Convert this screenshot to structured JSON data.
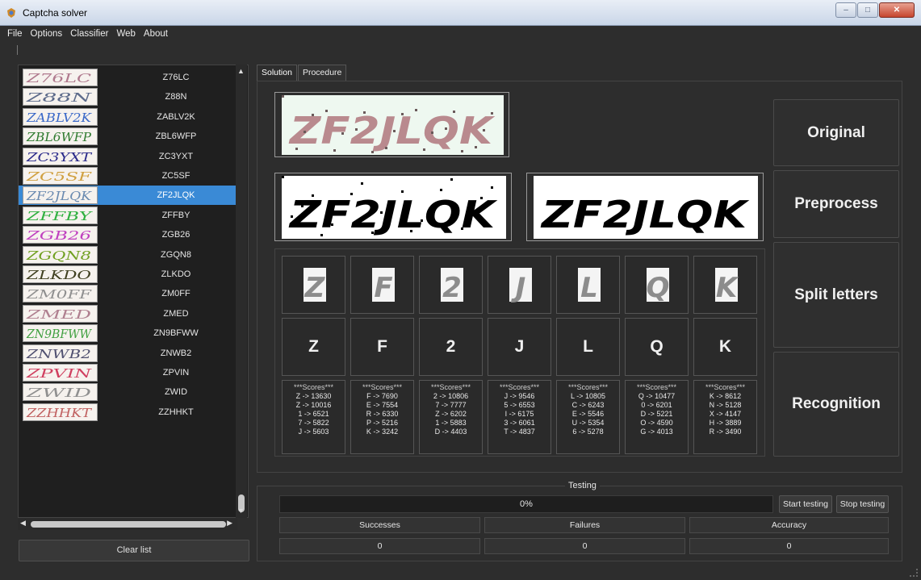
{
  "window": {
    "title": "Captcha solver"
  },
  "menu": [
    "File",
    "Options",
    "Classifier",
    "Web",
    "About"
  ],
  "captcha_list": [
    {
      "label": "Z76LC",
      "thumb_text": "Z76LC",
      "thumb_color": "#b07a8e",
      "selected": false
    },
    {
      "label": "Z88N",
      "thumb_text": "Z88N",
      "thumb_color": "#5c6a8a",
      "selected": false
    },
    {
      "label": "ZABLV2K",
      "thumb_text": "ZABLV2K",
      "thumb_color": "#3a68c8",
      "selected": false
    },
    {
      "label": "ZBL6WFP",
      "thumb_text": "ZBL6WFP",
      "thumb_color": "#2f7a2f",
      "selected": false
    },
    {
      "label": "ZC3YXT",
      "thumb_text": "ZC3YXT",
      "thumb_color": "#2a2a8a",
      "selected": false
    },
    {
      "label": "ZC5SF",
      "thumb_text": "ZC5SF",
      "thumb_color": "#d0a040",
      "selected": false
    },
    {
      "label": "ZF2JLQK",
      "thumb_text": "ZF2JLQK",
      "thumb_color": "#6a8ab0",
      "selected": true
    },
    {
      "label": "ZFFBY",
      "thumb_text": "ZFFBY",
      "thumb_color": "#30b040",
      "selected": false
    },
    {
      "label": "ZGB26",
      "thumb_text": "ZGB26",
      "thumb_color": "#c040c0",
      "selected": false
    },
    {
      "label": "ZGQN8",
      "thumb_text": "ZGQN8",
      "thumb_color": "#70a020",
      "selected": false
    },
    {
      "label": "ZLKDO",
      "thumb_text": "ZLKDO",
      "thumb_color": "#404020",
      "selected": false
    },
    {
      "label": "ZM0FF",
      "thumb_text": "ZM0FF",
      "thumb_color": "#909090",
      "selected": false
    },
    {
      "label": "ZMED",
      "thumb_text": "ZMED",
      "thumb_color": "#b08090",
      "selected": false
    },
    {
      "label": "ZN9BFWW",
      "thumb_text": "ZN9BFWW",
      "thumb_color": "#40a040",
      "selected": false
    },
    {
      "label": "ZNWB2",
      "thumb_text": "ZNWB2",
      "thumb_color": "#505070",
      "selected": false
    },
    {
      "label": "ZPVIN",
      "thumb_text": "ZPVIN",
      "thumb_color": "#d04060",
      "selected": false
    },
    {
      "label": "ZWID",
      "thumb_text": "ZWID",
      "thumb_color": "#909090",
      "selected": false
    },
    {
      "label": "ZZHHKT",
      "thumb_text": "ZZHHKT",
      "thumb_color": "#c06060",
      "selected": false
    }
  ],
  "clear_button": "Clear list",
  "tabs": [
    "Solution",
    "Procedure"
  ],
  "captcha": {
    "text": "ZF2JLQK",
    "original_color": "#b98a8e",
    "original_bg": "#eef8f0"
  },
  "side_buttons": [
    "Original",
    "Preprocess",
    "Split letters",
    "Recognition"
  ],
  "letters": [
    {
      "char": "Z",
      "scores_title": "***Scores***",
      "scores": [
        "Z -> 13630",
        "Z -> 10016",
        "1 -> 6521",
        "7 -> 5822",
        "J -> 5603"
      ]
    },
    {
      "char": "F",
      "scores_title": "***Scores***",
      "scores": [
        "F -> 7690",
        "E -> 7554",
        "R -> 6330",
        "P -> 5216",
        "K -> 3242"
      ]
    },
    {
      "char": "2",
      "scores_title": "***Scores***",
      "scores": [
        "2 -> 10806",
        "7 -> 7777",
        "Z -> 6202",
        "1 -> 5883",
        "D -> 4403"
      ]
    },
    {
      "char": "J",
      "scores_title": "***Scores***",
      "scores": [
        "J -> 9546",
        "5 -> 6553",
        "I -> 6175",
        "3 -> 6061",
        "T -> 4837"
      ]
    },
    {
      "char": "L",
      "scores_title": "***Scores***",
      "scores": [
        "L -> 10805",
        "C -> 6243",
        "E -> 5546",
        "U -> 5354",
        "6 -> 5278"
      ]
    },
    {
      "char": "Q",
      "scores_title": "***Scores***",
      "scores": [
        "Q -> 10477",
        "0 -> 6201",
        "D -> 5221",
        "O -> 4590",
        "G -> 4013"
      ]
    },
    {
      "char": "K",
      "scores_title": "***Scores***",
      "scores": [
        "K -> 8612",
        "N -> 5128",
        "X -> 4147",
        "H -> 3889",
        "R -> 3490"
      ]
    }
  ],
  "testing": {
    "label": "Testing",
    "progress_text": "0%",
    "progress": 0,
    "start_button": "Start testing",
    "stop_button": "Stop testing",
    "headers": [
      "Successes",
      "Failures",
      "Accuracy"
    ],
    "values": [
      "0",
      "0",
      "0"
    ]
  }
}
